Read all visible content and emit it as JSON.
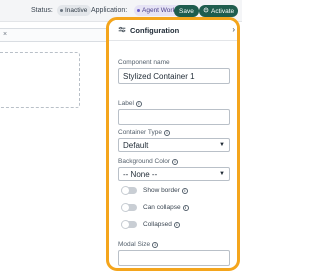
{
  "topbar": {
    "status_label": "Status:",
    "status_value": "Inactive",
    "application_label": "Application:",
    "application_value": "Agent Workspace",
    "save_label": "Save",
    "activate_label": "Activate",
    "activate_icon": "power-icon"
  },
  "config": {
    "title": "Configuration",
    "title_icon": "sliders-icon",
    "collapse_icon": "chevron-right-icon",
    "component_name_label": "Component name",
    "component_name_value": "Stylized Container 1",
    "label_label": "Label",
    "label_value": "",
    "container_type_label": "Container Type",
    "container_type_value": "Default",
    "background_color_label": "Background Color",
    "background_color_value": "-- None --",
    "toggles": [
      {
        "label": "Show border",
        "on": false
      },
      {
        "label": "Can collapse",
        "on": false
      },
      {
        "label": "Collapsed",
        "on": false
      }
    ],
    "modal_size_label": "Modal Size",
    "modal_size_value": "",
    "accent_color": "#f4a51c"
  }
}
